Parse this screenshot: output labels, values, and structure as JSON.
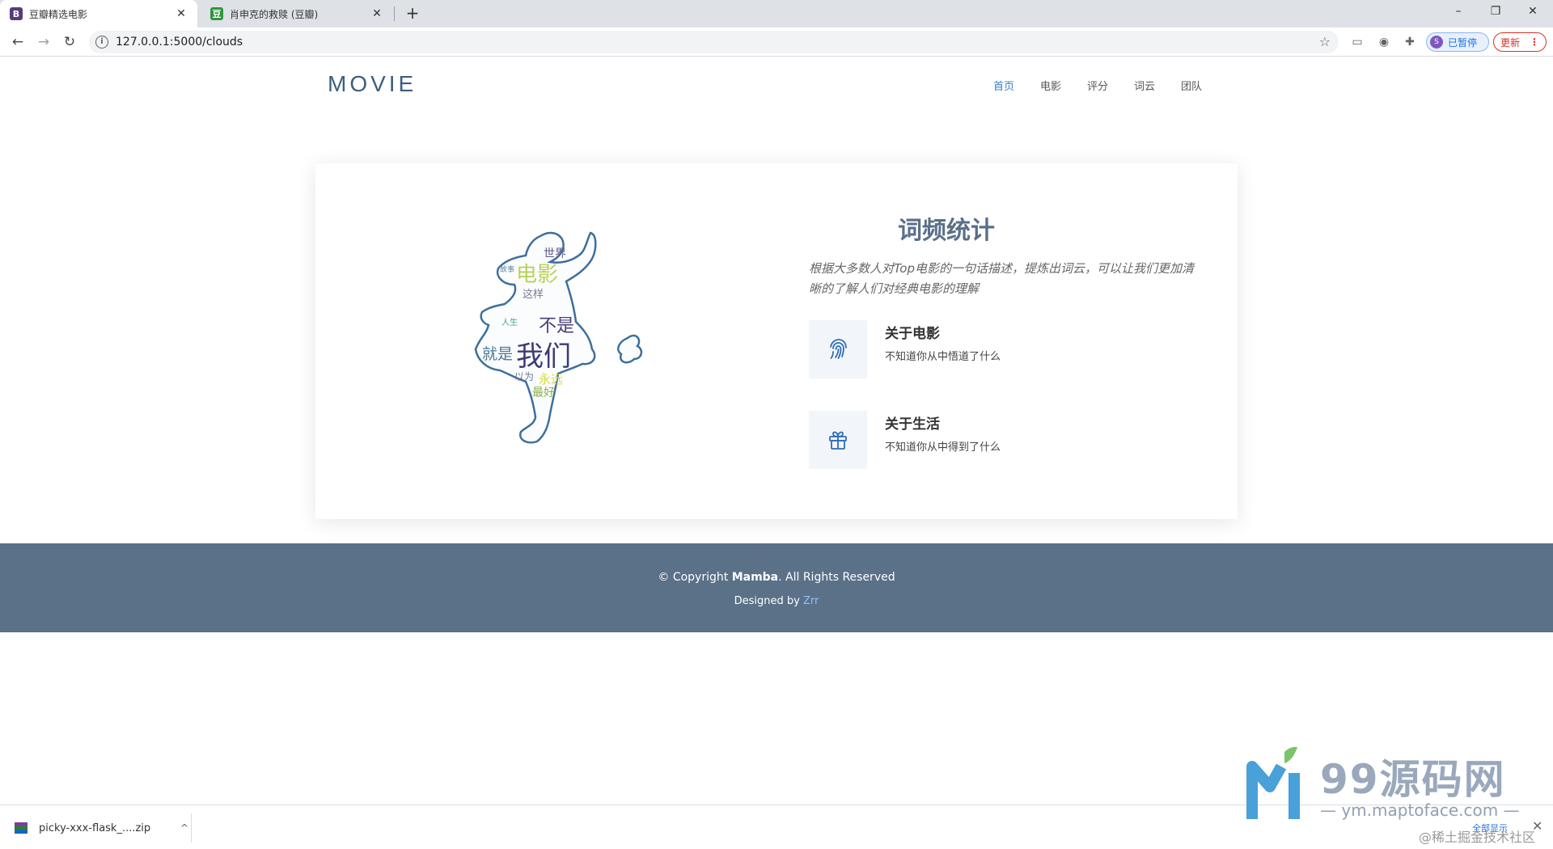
{
  "browser": {
    "tabs": [
      {
        "title": "豆瓣精选电影",
        "favicon": "B"
      },
      {
        "title": "肖申克的救赎 (豆瓣)",
        "favicon": "豆"
      }
    ],
    "new_tab": "+",
    "url": "127.0.0.1:5000/clouds",
    "profile_initial": "S",
    "profile_label": "已暂停",
    "update_label": "更新"
  },
  "site": {
    "brand": "MOVIE",
    "nav": [
      "首页",
      "电影",
      "评分",
      "词云",
      "团队"
    ]
  },
  "about": {
    "title": "词频统计",
    "description": "根据大多数人对Top电影的一句话描述，提炼出词云，可以让我们更加清晰的了解人们对经典电影的理解",
    "features": [
      {
        "icon": "fingerprint-icon",
        "title": "关于电影",
        "text": "不知道你从中悟道了什么"
      },
      {
        "icon": "gift-icon",
        "title": "关于生活",
        "text": "不知道你从中得到了什么"
      }
    ],
    "cloud_words": [
      "世界",
      "电影",
      "这样",
      "不是",
      "就是",
      "我们",
      "永远",
      "以为",
      "最好",
      "故事",
      "人生"
    ]
  },
  "footer": {
    "copyright_prefix": "© Copyright",
    "copyright_name": "Mamba",
    "copyright_suffix": ". All Rights Reserved",
    "designed_prefix": "Designed by",
    "designed_link": "Zrr"
  },
  "downloads": {
    "file": "picky-xxx-flask_....zip",
    "show_all": "全部显示"
  },
  "watermark": {
    "title": "99源码网",
    "url": "— ym.maptoface.com —",
    "sub": "@稀土掘金技术社区"
  },
  "colors": {
    "brand": "#3b5f80",
    "nav_active": "#3e7cc3",
    "footer_bg": "#5a7188",
    "icon_blue": "#2f6db3"
  }
}
